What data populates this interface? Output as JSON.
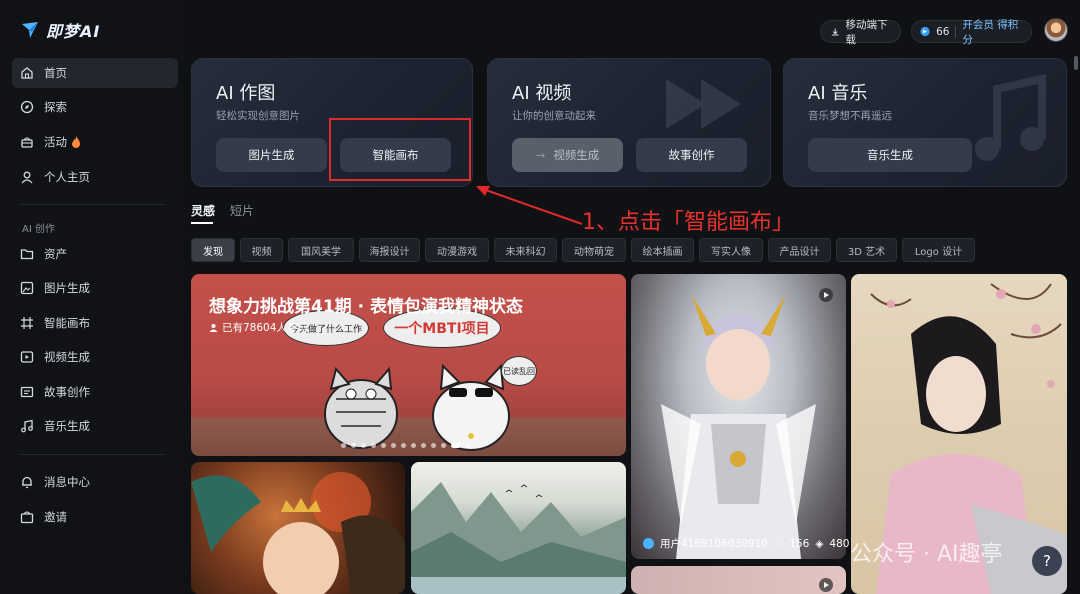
{
  "app": {
    "logo_text": "即梦AI"
  },
  "sidebar": {
    "items": [
      {
        "label": "首页",
        "icon": "home-icon"
      },
      {
        "label": "探索",
        "icon": "compass-icon"
      },
      {
        "label": "活动",
        "icon": "gift-icon",
        "badge": "fire-icon"
      },
      {
        "label": "个人主页",
        "icon": "user-icon"
      }
    ],
    "section_title": "AI 创作",
    "create_items": [
      {
        "label": "资产",
        "icon": "folder-icon"
      },
      {
        "label": "图片生成",
        "icon": "image-gen-icon"
      },
      {
        "label": "智能画布",
        "icon": "canvas-icon"
      },
      {
        "label": "视频生成",
        "icon": "video-gen-icon"
      },
      {
        "label": "故事创作",
        "icon": "story-icon"
      },
      {
        "label": "音乐生成",
        "icon": "music-icon"
      }
    ],
    "bottom_items": [
      {
        "label": "消息中心",
        "icon": "bell-icon"
      },
      {
        "label": "邀请",
        "icon": "invite-icon"
      }
    ]
  },
  "header": {
    "download_label": "移动端下载",
    "points": "66",
    "member_label": "开会员 得积分"
  },
  "cards": [
    {
      "title": "AI 作图",
      "subtitle": "轻松实现创意图片",
      "buttons": [
        "图片生成",
        "智能画布"
      ]
    },
    {
      "title": "AI 视频",
      "subtitle": "让你的创意动起来",
      "buttons": [
        "视频生成",
        "故事创作"
      ]
    },
    {
      "title": "AI 音乐",
      "subtitle": "音乐梦想不再遥远",
      "buttons": [
        "音乐生成"
      ]
    }
  ],
  "annotation": {
    "text": "1、点击「智能画布」"
  },
  "tabs": [
    "灵感",
    "短片"
  ],
  "chips": [
    "发现",
    "视频",
    "国风美学",
    "海报设计",
    "动漫游戏",
    "未来科幻",
    "动物萌宠",
    "绘本插画",
    "写实人像",
    "产品设计",
    "3D 艺术",
    "Logo 设计"
  ],
  "banner": {
    "title": "想象力挑战第41期 · 表情包演我精神状态",
    "subtitle": "已有78604人参与",
    "bubble_left": "今天做了什么工作",
    "bubble_mid": "一个MBTI项目",
    "bubble_right": "已读乱回"
  },
  "mecha_card": {
    "user": "用户4169106030910",
    "likes": "156",
    "views": "480"
  },
  "watermark": "公众号 · AI趣亭",
  "help_label": "?",
  "colors": {
    "accent_red": "#e02a2a",
    "member_blue": "#3aa0ff"
  }
}
